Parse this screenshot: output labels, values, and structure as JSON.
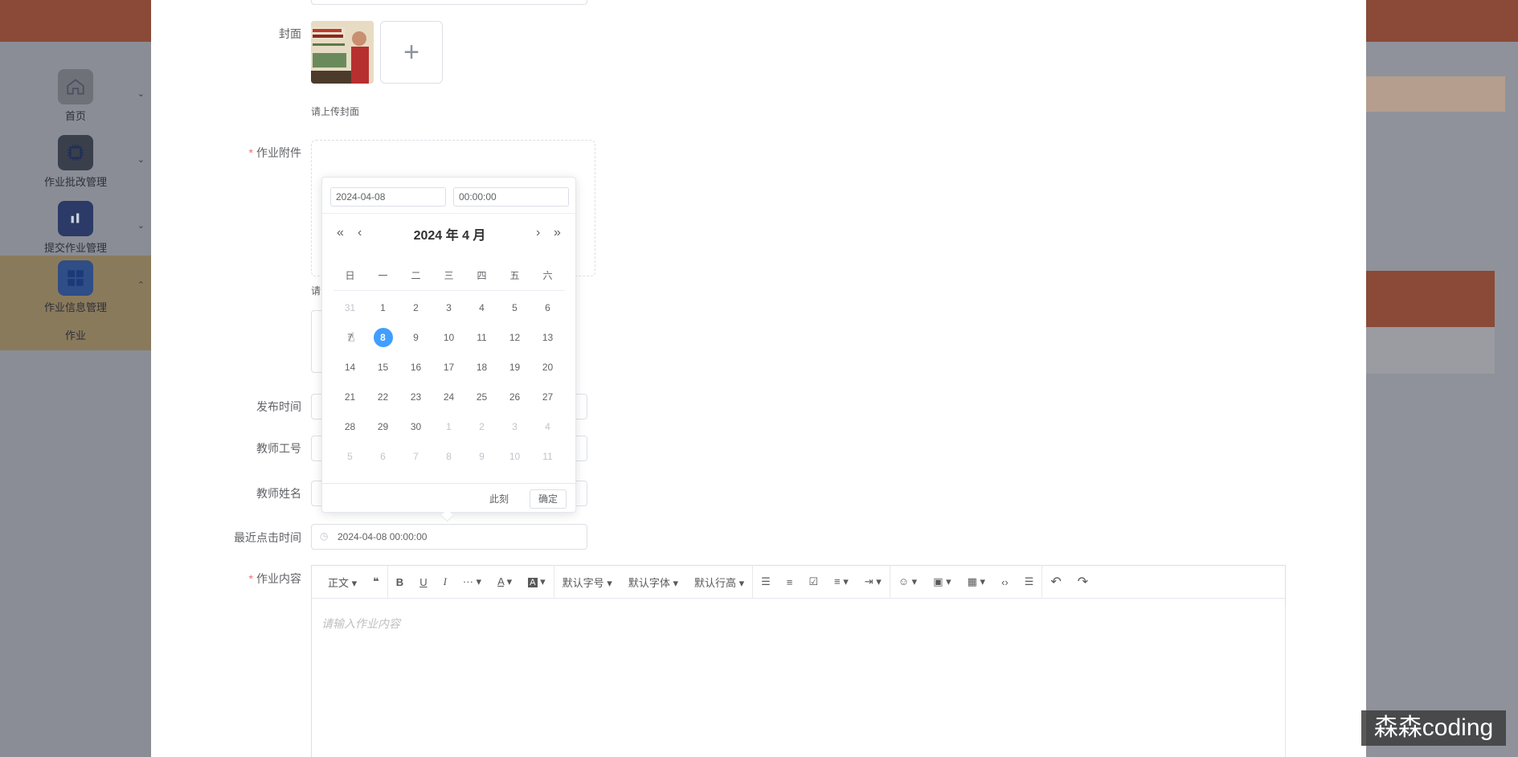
{
  "sidebar": {
    "items": [
      {
        "label": "首页",
        "icon": "home-icon"
      },
      {
        "label": "作业批改管理",
        "icon": "chip-icon"
      },
      {
        "label": "提交作业管理",
        "icon": "chart-icon"
      },
      {
        "label": "作业信息管理",
        "icon": "grid-icon"
      }
    ],
    "sub_item": "作业"
  },
  "form": {
    "cover_label": "封面",
    "cover_add": "+",
    "cover_hint": "请上传封面",
    "attachment_label": "作业附件",
    "attachment_hint_partial": "请",
    "publish_time_label": "发布时间",
    "teacher_id_label": "教师工号",
    "teacher_name_label": "教师姓名",
    "last_click_label": "最近点击时间",
    "last_click_value": "2024-04-08 00:00:00",
    "content_label": "作业内容",
    "content_placeholder": "请输入作业内容"
  },
  "toolbar": {
    "paragraph": "正文",
    "quote": "❝",
    "bold": "B",
    "underline": "U",
    "italic": "I",
    "more": "···",
    "font_color": "A",
    "bg_color": "A",
    "font_size": "默认字号",
    "font_family": "默认字体",
    "line_height": "默认行高",
    "undo": "↶",
    "redo": "↷"
  },
  "picker": {
    "date_value": "2024-04-08",
    "time_value": "00:00:00",
    "title": "2024 年  4 月",
    "prev_year": "«",
    "prev_month": "‹",
    "next_month": "›",
    "next_year": "»",
    "weekdays": [
      "日",
      "一",
      "二",
      "三",
      "四",
      "五",
      "六"
    ],
    "weeks": [
      [
        "31",
        "1",
        "2",
        "3",
        "4",
        "5",
        "6"
      ],
      [
        "7",
        "8",
        "9",
        "10",
        "11",
        "12",
        "13"
      ],
      [
        "14",
        "15",
        "16",
        "17",
        "18",
        "19",
        "20"
      ],
      [
        "21",
        "22",
        "23",
        "24",
        "25",
        "26",
        "27"
      ],
      [
        "28",
        "29",
        "30",
        "1",
        "2",
        "3",
        "4"
      ],
      [
        "5",
        "6",
        "7",
        "8",
        "9",
        "10",
        "11"
      ]
    ],
    "selected": "8",
    "now_label": "此刻",
    "ok_label": "确定"
  },
  "watermark": "森森coding",
  "colors": {
    "accent": "#409eff",
    "topbar": "#8a4a37",
    "required": "#f56c6c"
  }
}
